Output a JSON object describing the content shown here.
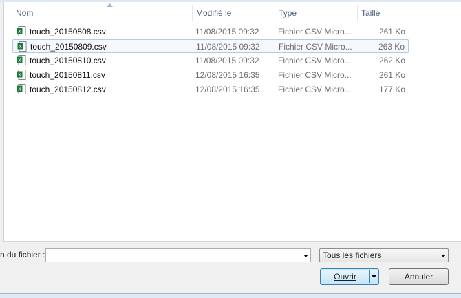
{
  "columns": {
    "name": "Nom",
    "modified": "Modifié le",
    "type": "Type",
    "size": "Taille"
  },
  "files": [
    {
      "name": "touch_20150808.csv",
      "modified": "11/08/2015 09:32",
      "type": "Fichier CSV Micro...",
      "size": "261 Ko"
    },
    {
      "name": "touch_20150809.csv",
      "modified": "11/08/2015 09:32",
      "type": "Fichier CSV Micro...",
      "size": "263 Ko"
    },
    {
      "name": "touch_20150810.csv",
      "modified": "11/08/2015 09:32",
      "type": "Fichier CSV Micro...",
      "size": "262 Ko"
    },
    {
      "name": "touch_20150811.csv",
      "modified": "12/08/2015 16:35",
      "type": "Fichier CSV Micro...",
      "size": "261 Ko"
    },
    {
      "name": "touch_20150812.csv",
      "modified": "12/08/2015 16:35",
      "type": "Fichier CSV Micro...",
      "size": "177 Ko"
    }
  ],
  "selected_index": 1,
  "filename": {
    "label": "n du fichier :",
    "value": ""
  },
  "filter": {
    "selected": "Tous les fichiers"
  },
  "buttons": {
    "open": "Ouvrir",
    "cancel": "Annuler"
  },
  "colors": {
    "accent": "#3c7fb1",
    "excel_green": "#1d7a3c"
  },
  "icons": {
    "file": "excel-csv-file-icon",
    "sort": "sort-ascending-icon",
    "dropdown": "chevron-down-icon"
  }
}
